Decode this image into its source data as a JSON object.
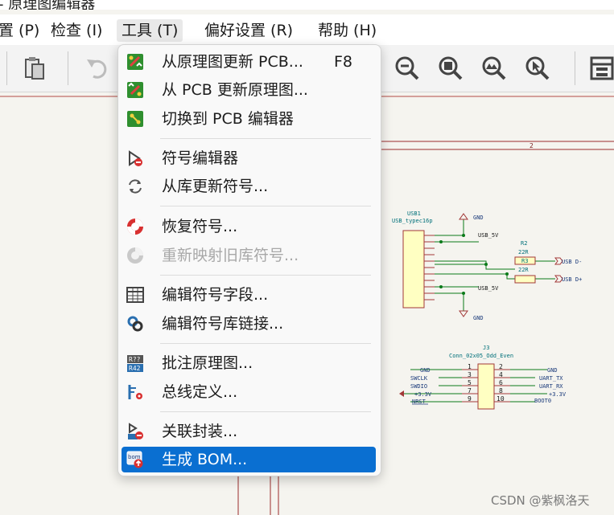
{
  "window": {
    "title": "- 原理图编辑器"
  },
  "menubar": [
    {
      "label": "置 (P)"
    },
    {
      "label": "检查 (I)"
    },
    {
      "label": "工具 (T)"
    },
    {
      "label": "偏好设置 (R)"
    },
    {
      "label": "帮助 (H)"
    }
  ],
  "tools_menu": {
    "items": [
      {
        "label": "从原理图更新 PCB...",
        "shortcut": "F8",
        "icon": "update-pcb-icon"
      },
      {
        "label": "从 PCB 更新原理图...",
        "icon": "update-schematic-icon"
      },
      {
        "label": "切换到 PCB 编辑器",
        "icon": "pcb-editor-icon"
      },
      {
        "label": "符号编辑器",
        "icon": "symbol-editor-icon"
      },
      {
        "label": "从库更新符号...",
        "icon": "refresh-icon"
      },
      {
        "label": "恢复符号...",
        "icon": "rescue-icon"
      },
      {
        "label": "重新映射旧库符号...",
        "icon": "remap-icon",
        "disabled": true
      },
      {
        "label": "编辑符号字段...",
        "icon": "table-icon"
      },
      {
        "label": "编辑符号库链接...",
        "icon": "link-icon"
      },
      {
        "label": "批注原理图...",
        "icon": "annotate-icon"
      },
      {
        "label": "总线定义...",
        "icon": "bus-definition-icon"
      },
      {
        "label": "关联封装...",
        "icon": "assign-footprint-icon"
      },
      {
        "label": "生成 BOM...",
        "icon": "bom-icon",
        "highlighted": true
      }
    ]
  },
  "schematic": {
    "sheet_border_label": "2",
    "usb": {
      "ref": "USB1",
      "value": "USB_typec16p"
    },
    "r2": {
      "ref": "R2",
      "value": "22R"
    },
    "r3": {
      "ref": "R3",
      "value": "22R"
    },
    "nets": {
      "gnd": "GND",
      "usb5v": "USB_5V",
      "usbdm": "USB D-",
      "usbdp": "USB D+",
      "swclk": "SWCLK",
      "swdio": "SWDIO",
      "nrst": "NRST",
      "uart_tx": "UART_TX",
      "uart_rx": "UART_RX",
      "boot0": "BOOT0",
      "v33": "+3.3V"
    },
    "j3": {
      "ref": "J3",
      "value": "Conn_02x05_Odd_Even",
      "pins_left": [
        "1",
        "3",
        "5",
        "7",
        "9"
      ],
      "pins_right": [
        "2",
        "4",
        "6",
        "8",
        "10"
      ]
    }
  },
  "watermark": "CSDN @紫枫洛天"
}
